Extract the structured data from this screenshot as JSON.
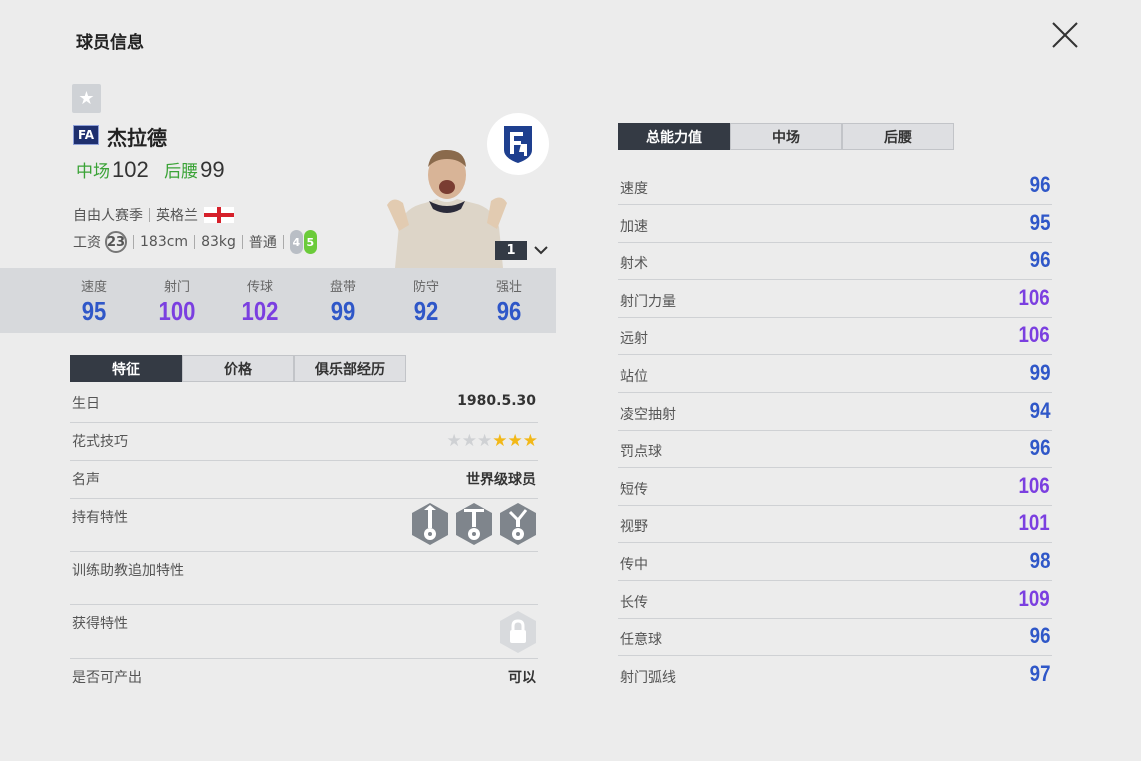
{
  "header": {
    "title": "球员信息",
    "close_icon": "close-icon"
  },
  "player": {
    "badge": "FA",
    "name": "杰拉德",
    "positions": [
      {
        "pos": "中场",
        "ovr": "102"
      },
      {
        "pos": "后腰",
        "ovr": "99"
      }
    ],
    "season": "自由人赛季",
    "nation": "英格兰",
    "wage_label": "工资",
    "wage": "23",
    "height": "183cm",
    "weight": "83kg",
    "body_type": "普通",
    "weak_foot": "4",
    "strong_foot": "5",
    "level": "1"
  },
  "main_stats": [
    {
      "label": "速度",
      "value": "95",
      "color": "#2f57c8"
    },
    {
      "label": "射门",
      "value": "100",
      "color": "#7b3fe0"
    },
    {
      "label": "传球",
      "value": "102",
      "color": "#7b3fe0"
    },
    {
      "label": "盘带",
      "value": "99",
      "color": "#2f57c8"
    },
    {
      "label": "防守",
      "value": "92",
      "color": "#2f57c8"
    },
    {
      "label": "强壮",
      "value": "96",
      "color": "#2f57c8"
    }
  ],
  "left_tabs": [
    "特征",
    "价格",
    "俱乐部经历"
  ],
  "info": {
    "birthday_label": "生日",
    "birthday": "1980.5.30",
    "skill_label": "花式技巧",
    "skill_stars": 3,
    "skill_max": 6,
    "reputation_label": "名声",
    "reputation": "世界级球员",
    "traits_label": "持有特性",
    "coach_traits_label": "训练助教追加特性",
    "acquired_label": "获得特性",
    "tradable_label": "是否可产出",
    "tradable": "可以"
  },
  "right_tabs": [
    "总能力值",
    "中场",
    "后腰"
  ],
  "attributes": [
    {
      "label": "速度",
      "value": "96",
      "color": "#2f57c8"
    },
    {
      "label": "加速",
      "value": "95",
      "color": "#2f57c8"
    },
    {
      "label": "射术",
      "value": "96",
      "color": "#2f57c8"
    },
    {
      "label": "射门力量",
      "value": "106",
      "color": "#7b3fe0"
    },
    {
      "label": "远射",
      "value": "106",
      "color": "#7b3fe0"
    },
    {
      "label": "站位",
      "value": "99",
      "color": "#2f57c8"
    },
    {
      "label": "凌空抽射",
      "value": "94",
      "color": "#2f57c8"
    },
    {
      "label": "罚点球",
      "value": "96",
      "color": "#2f57c8"
    },
    {
      "label": "短传",
      "value": "106",
      "color": "#7b3fe0"
    },
    {
      "label": "视野",
      "value": "101",
      "color": "#7b3fe0"
    },
    {
      "label": "传中",
      "value": "98",
      "color": "#2f57c8"
    },
    {
      "label": "长传",
      "value": "109",
      "color": "#7b3fe0"
    },
    {
      "label": "任意球",
      "value": "96",
      "color": "#2f57c8"
    },
    {
      "label": "射门弧线",
      "value": "97",
      "color": "#2f57c8"
    }
  ]
}
